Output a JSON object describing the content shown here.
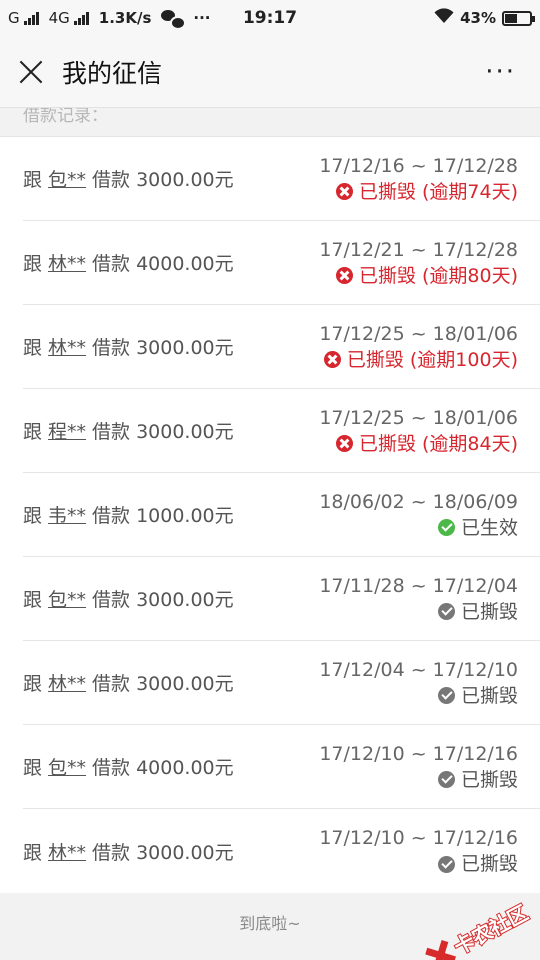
{
  "status_bar": {
    "carrier_1": "G",
    "carrier_2": "4G",
    "speed": "1.3K/s",
    "dots": "···",
    "time": "19:17",
    "battery": "43%"
  },
  "header": {
    "title": "我的征信",
    "more": "···"
  },
  "section_label": "借款记录：",
  "records": [
    {
      "prefix": "跟",
      "name": "包**",
      "amount": "借款 3000.00元",
      "date": "17/12/16 ~ 17/12/28",
      "status": "已撕毁 (逾期74天)",
      "kind": "overdue"
    },
    {
      "prefix": "跟",
      "name": "林**",
      "amount": "借款 4000.00元",
      "date": "17/12/21 ~ 17/12/28",
      "status": "已撕毁 (逾期80天)",
      "kind": "overdue"
    },
    {
      "prefix": "跟",
      "name": "林**",
      "amount": "借款 3000.00元",
      "date": "17/12/25 ~ 18/01/06",
      "status": "已撕毁 (逾期100天)",
      "kind": "overdue"
    },
    {
      "prefix": "跟",
      "name": "程**",
      "amount": "借款 3000.00元",
      "date": "17/12/25 ~ 18/01/06",
      "status": "已撕毁 (逾期84天)",
      "kind": "overdue"
    },
    {
      "prefix": "跟",
      "name": "韦**",
      "amount": "借款 1000.00元",
      "date": "18/06/02 ~ 18/06/09",
      "status": "已生效",
      "kind": "active"
    },
    {
      "prefix": "跟",
      "name": "包**",
      "amount": "借款 3000.00元",
      "date": "17/11/28 ~ 17/12/04",
      "status": "已撕毁",
      "kind": "closed"
    },
    {
      "prefix": "跟",
      "name": "林**",
      "amount": "借款 3000.00元",
      "date": "17/12/04 ~ 17/12/10",
      "status": "已撕毁",
      "kind": "closed"
    },
    {
      "prefix": "跟",
      "name": "包**",
      "amount": "借款 4000.00元",
      "date": "17/12/10 ~ 17/12/16",
      "status": "已撕毁",
      "kind": "closed"
    },
    {
      "prefix": "跟",
      "name": "林**",
      "amount": "借款 3000.00元",
      "date": "17/12/10 ~ 17/12/16",
      "status": "已撕毁",
      "kind": "closed"
    }
  ],
  "status_colors": {
    "overdue": "#d7262e",
    "active": "#555555",
    "closed": "#555555"
  },
  "footer": "到底啦~",
  "watermark": "卡农社区"
}
